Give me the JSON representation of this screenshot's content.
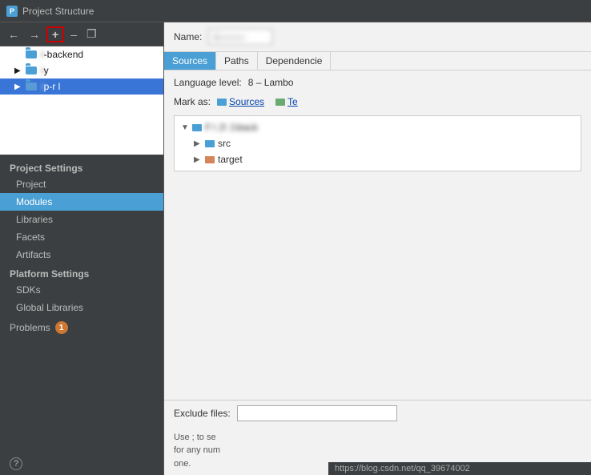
{
  "titleBar": {
    "title": "Project Structure"
  },
  "toolbar": {
    "addLabel": "+",
    "removeLabel": "–",
    "copyLabel": "❐",
    "backLabel": "←",
    "forwardLabel": "→"
  },
  "moduleTree": {
    "items": [
      {
        "id": "item1",
        "label": "-backend",
        "blurred": "i",
        "indent": 1,
        "selected": false
      },
      {
        "id": "item2",
        "label": "y",
        "blurred": "i",
        "indent": 1,
        "selected": false,
        "hasChevron": true
      },
      {
        "id": "item3",
        "label": "p-r l",
        "blurred": "i",
        "indent": 1,
        "selected": true
      }
    ]
  },
  "sidebar": {
    "projectSettings": "Project Settings",
    "project": "Project",
    "modules": "Modules",
    "libraries": "Libraries",
    "facets": "Facets",
    "artifacts": "Artifacts",
    "platformSettings": "Platform Settings",
    "sdks": "SDKs",
    "globalLibraries": "Global Libraries",
    "problems": "Problems",
    "problemsCount": "1"
  },
  "content": {
    "nameLabel": "Name:",
    "nameValue": "i------",
    "tabs": [
      {
        "id": "sources",
        "label": "Sources",
        "active": true
      },
      {
        "id": "paths",
        "label": "Paths",
        "active": false
      },
      {
        "id": "dependencies",
        "label": "Dependencie",
        "active": false
      }
    ],
    "languageLevelLabel": "Language level:",
    "languageLevelValue": "8 – Lambo",
    "markAsLabel": "Mark as:",
    "markAsSource": "Sources",
    "markAsTests": "Te",
    "pathRoot": "F:\\",
    "pathMiddle": "2\\",
    "pathEnd": "1\\back",
    "srcLabel": "src",
    "targetLabel": "target",
    "excludeLabel": "Exclude files:",
    "hintLine1": "Use ; to se",
    "hintLine2": "for any num",
    "hintLine3": "one.",
    "urlBar": "https://blog.csdn.net/qq_39674002"
  }
}
